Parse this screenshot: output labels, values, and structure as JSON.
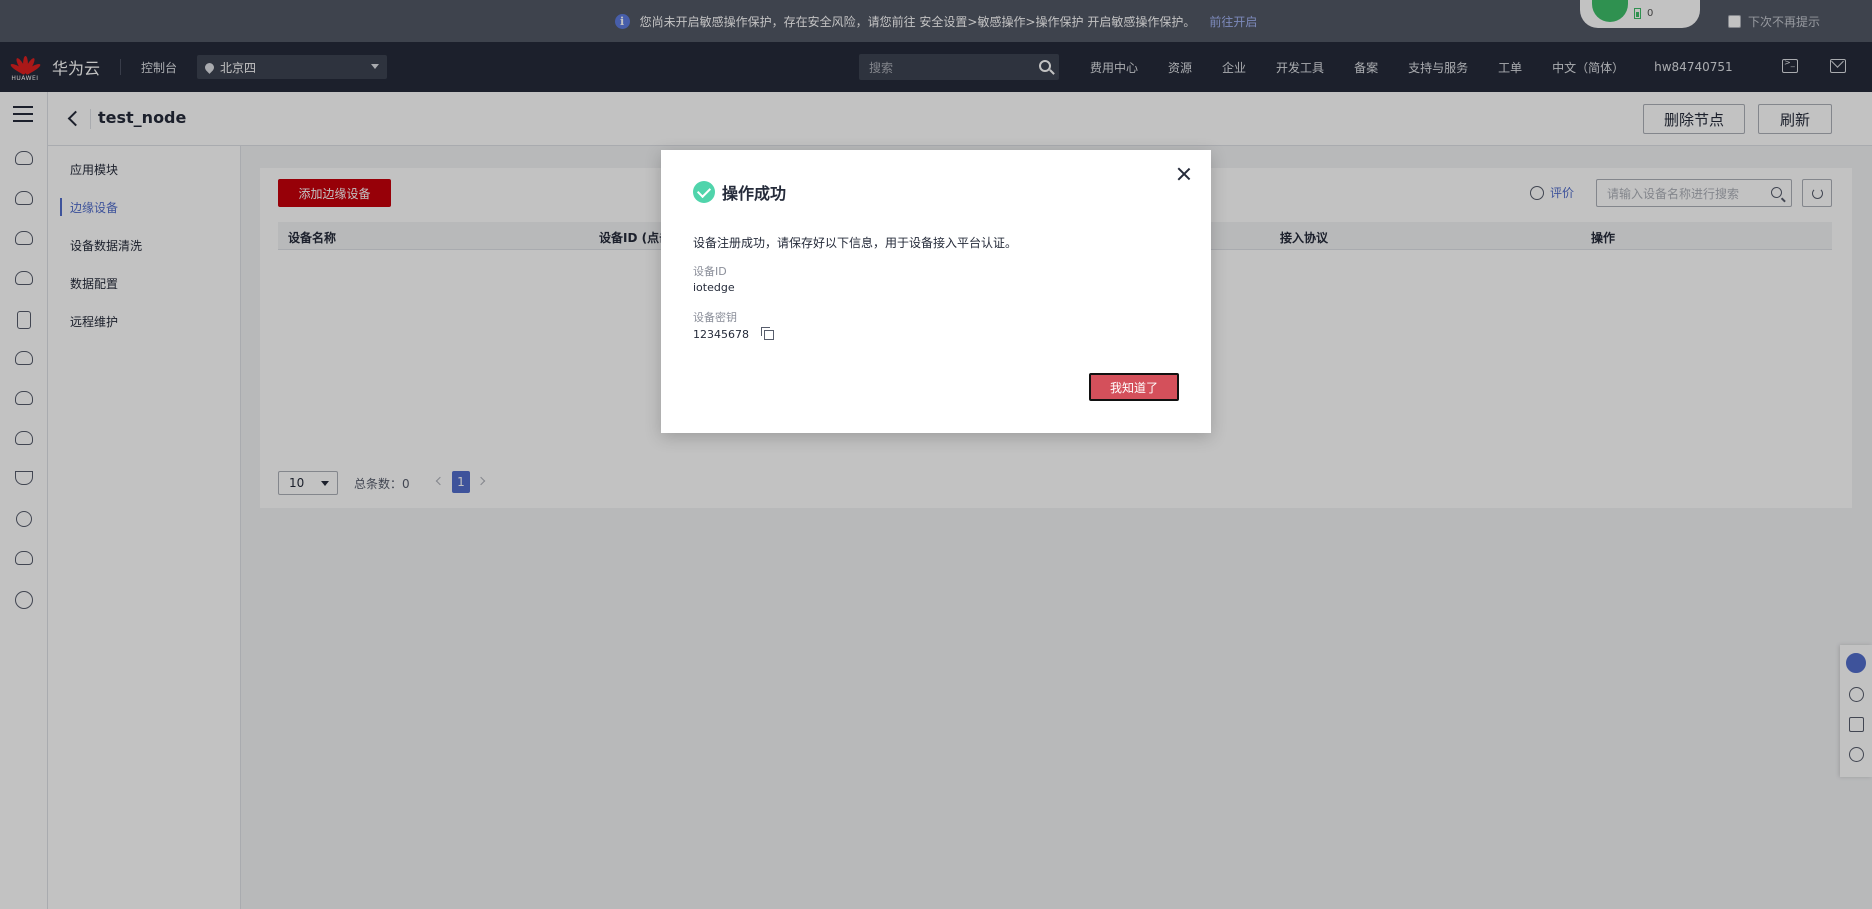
{
  "banner": {
    "message": "您尚未开启敏感操作保护，存在安全风险，请您前往 安全设置>敏感操作>操作保护 开启敏感操作保护。",
    "link": "前往开启",
    "dont_show": "下次不再提示",
    "battery": "0"
  },
  "header": {
    "logo_text": "HUAWEI",
    "brand": "华为云",
    "console": "控制台",
    "region": "北京四",
    "search_placeholder": "搜索",
    "nav": [
      "费用中心",
      "资源",
      "企业",
      "开发工具",
      "备案",
      "支持与服务",
      "工单",
      "中文（简体）",
      "hw84740751"
    ]
  },
  "page": {
    "title": "test_node",
    "delete_node": "删除节点",
    "refresh": "刷新"
  },
  "subnav": {
    "items": [
      "应用模块",
      "边缘设备",
      "设备数据清洗",
      "数据配置",
      "远程维护"
    ],
    "active_index": 1
  },
  "content": {
    "add_button": "添加边缘设备",
    "rate": "评价",
    "search_placeholder": "请输入设备名称进行搜索",
    "columns": [
      "设备名称",
      "设备ID (点击",
      "接入协议",
      "操作"
    ],
    "page_size": "10",
    "total": "总条数：0",
    "current_page": "1"
  },
  "modal": {
    "title": "操作成功",
    "message": "设备注册成功，请保存好以下信息，用于设备接入平台认证。",
    "device_id_label": "设备ID",
    "device_id": "iotedge",
    "device_secret_label": "设备密钥",
    "device_secret": "12345678",
    "ok_button": "我知道了"
  },
  "colors": {
    "header_bg": "#252b3a",
    "banner_bg": "#525866",
    "primary_red": "#c7000b",
    "accent_blue": "#526ecc",
    "success_green": "#50d4ab"
  }
}
